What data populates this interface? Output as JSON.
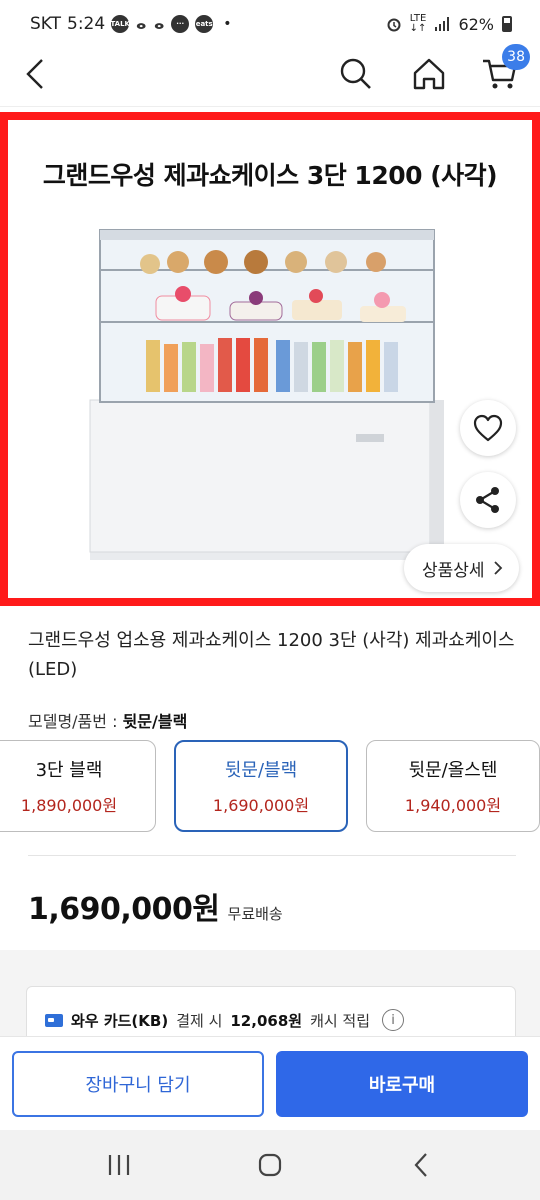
{
  "status_bar": {
    "carrier": "SKT",
    "time": "5:24",
    "notif_talk": "TALK",
    "notif_eats": "eats",
    "notif_dot": "•",
    "network": "LTE",
    "network_arrows": "↓↑",
    "battery": "62%"
  },
  "app_bar": {
    "cart_count": "38"
  },
  "product_image": {
    "title": "그랜드우성 제과쇼케이스 3단 1200 (사각)",
    "detail_label": "상품상세"
  },
  "product": {
    "name": "그랜드우성 업소용 제과쇼케이스 1200 3단 (사각) 제과쇼케이스 (LED)",
    "option_label": "모델명/품번 : ",
    "option_selected": "뒷문/블랙",
    "options": [
      {
        "name": "3단 블랙",
        "price": "1,890,000원"
      },
      {
        "name": "뒷문/블랙",
        "price": "1,690,000원"
      },
      {
        "name": "뒷문/올스텐",
        "price": "1,940,000원"
      }
    ],
    "price": "1,690,000원",
    "shipping": "무료배송"
  },
  "card_benefit": {
    "card_name": "와우 카드(KB)",
    "text_mid": "결제 시",
    "amount": "12,068원",
    "text_end": "캐시 적립",
    "info": "i"
  },
  "actions": {
    "add_to_cart": "장바구니 담기",
    "buy_now": "바로구매"
  },
  "colors": {
    "accent": "#2f68e8",
    "selected_border": "#2a63b8",
    "price_red": "#b3261e",
    "image_frame": "#ff1a1a"
  }
}
